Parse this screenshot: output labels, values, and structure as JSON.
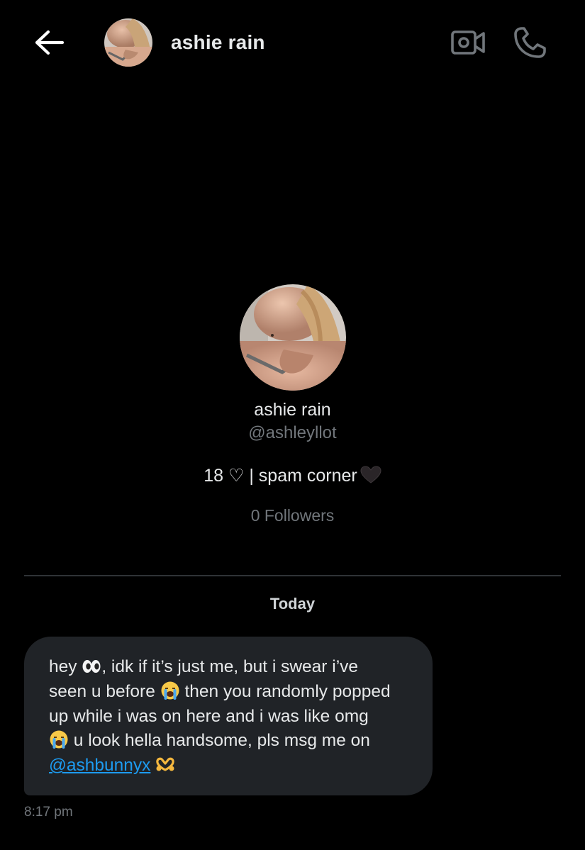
{
  "header": {
    "title": "ashie rain"
  },
  "profile": {
    "name": "ashie rain",
    "handle": "@ashleyllot",
    "bio": "18 ♡ | spam corner",
    "followers": "0 Followers"
  },
  "conversation": {
    "date_label": "Today",
    "message": {
      "line1_a": "hey ",
      "line1_b": ", idk if it’s just me, but i swear i’ve",
      "line2_a": "seen u before ",
      "line2_b": " then you randomly popped",
      "line3": "up while i was on here and i was like omg",
      "line4": " u look hella handsome, pls msg me on",
      "mention": "@ashbunnyx",
      "time": "8:17 pm"
    }
  },
  "colors": {
    "background": "#000000",
    "bubble": "#202327",
    "text": "#e7e9ea",
    "muted": "#71767b",
    "link": "#1d9bf0",
    "divider": "#2f3336"
  },
  "icons": [
    "back-arrow-icon",
    "video-call-icon",
    "phone-icon",
    "black-heart-emoji",
    "eyes-emoji",
    "crying-face-emoji",
    "heart-hands-emoji"
  ]
}
